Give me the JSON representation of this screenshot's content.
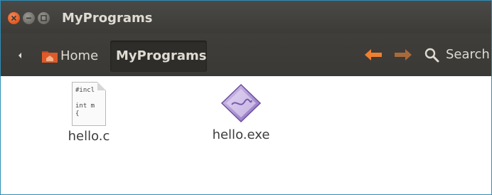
{
  "window": {
    "title": "MyPrograms",
    "accent": "#2f8fb8",
    "controls": [
      "close-icon",
      "minimize-icon",
      "maximize-icon"
    ]
  },
  "toolbar": {
    "breadcrumbs": [
      {
        "label": "Home",
        "icon": "home-folder-icon"
      },
      {
        "label": "MyPrograms"
      }
    ],
    "back_icon": "arrow-left-icon",
    "forward_icon": "arrow-right-icon",
    "search_label": "Search"
  },
  "files": [
    {
      "name": "hello.c",
      "icon": "c-source-file-icon",
      "preview": "#incl\n\nint m\n{"
    },
    {
      "name": "hello.exe",
      "icon": "executable-icon"
    }
  ]
}
